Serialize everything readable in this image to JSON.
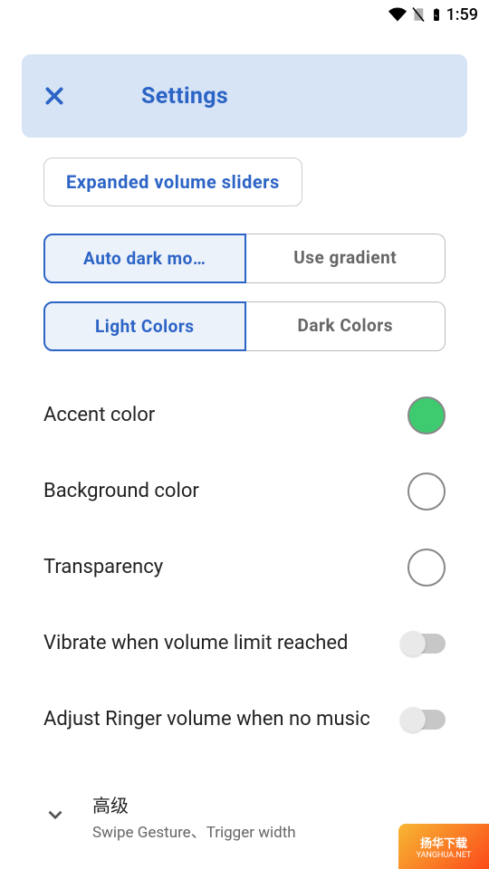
{
  "status": {
    "time": "1:59"
  },
  "header": {
    "title": "Settings"
  },
  "expanded_btn": "Expanded volume sliders",
  "seg1": {
    "left": "Auto dark mo…",
    "right": "Use gradient"
  },
  "seg2": {
    "left": "Light Colors",
    "right": "Dark Colors"
  },
  "rows": {
    "accent": "Accent color",
    "background": "Background color",
    "transparency": "Transparency",
    "vibrate": "Vibrate when volume limit reached",
    "adjust": "Adjust Ringer volume when no music"
  },
  "advanced": {
    "title": "高级",
    "subtitle": "Swipe Gesture、Trigger width"
  },
  "watermark": {
    "text": "扬华下载",
    "url": "YANGHUA.NET"
  }
}
